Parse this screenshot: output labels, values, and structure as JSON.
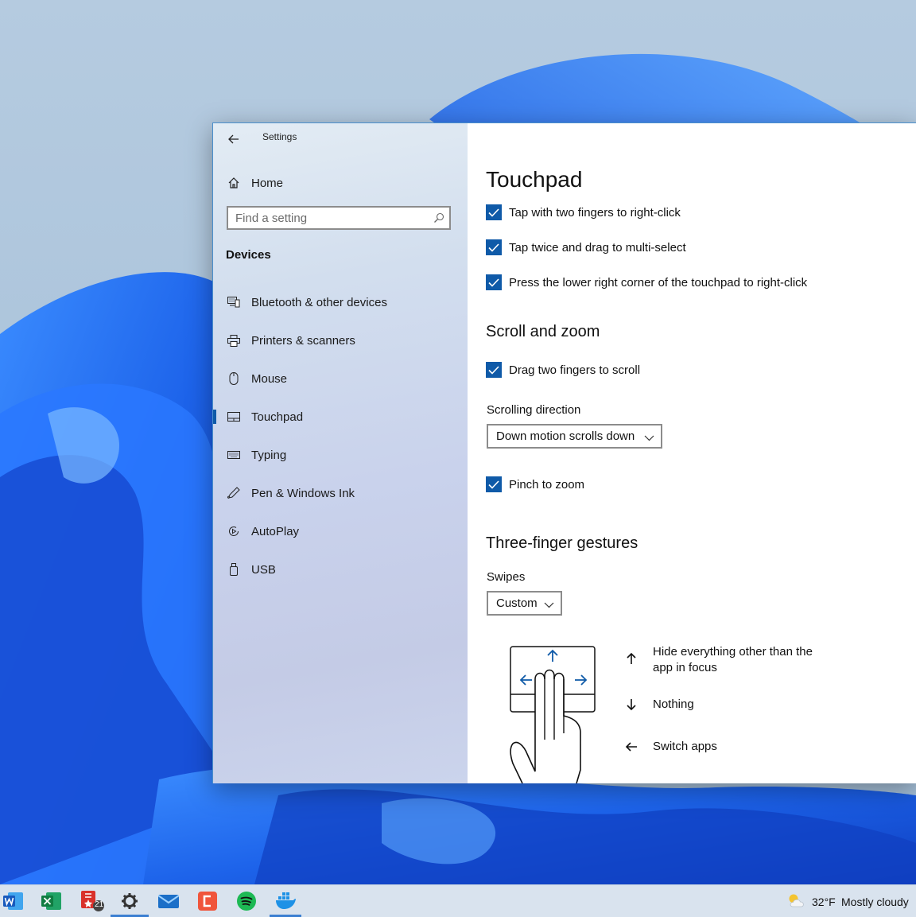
{
  "window": {
    "title": "Settings",
    "back_icon": "back-arrow-icon"
  },
  "sidebar": {
    "home_label": "Home",
    "search_placeholder": "Find a setting",
    "section": "Devices",
    "items": [
      {
        "label": "Bluetooth & other devices",
        "icon": "bluetooth-devices-icon"
      },
      {
        "label": "Printers & scanners",
        "icon": "printer-icon"
      },
      {
        "label": "Mouse",
        "icon": "mouse-icon"
      },
      {
        "label": "Touchpad",
        "icon": "touchpad-icon",
        "selected": true
      },
      {
        "label": "Typing",
        "icon": "keyboard-icon"
      },
      {
        "label": "Pen & Windows Ink",
        "icon": "pen-icon"
      },
      {
        "label": "AutoPlay",
        "icon": "autoplay-icon"
      },
      {
        "label": "USB",
        "icon": "usb-icon"
      }
    ]
  },
  "main": {
    "title": "Touchpad",
    "taps": [
      {
        "label": "Tap with two fingers to right-click",
        "checked": true
      },
      {
        "label": "Tap twice and drag to multi-select",
        "checked": true
      },
      {
        "label": "Press the lower right corner of the touchpad to right-click",
        "checked": true
      }
    ],
    "scroll_zoom": {
      "heading": "Scroll and zoom",
      "drag_scroll": {
        "label": "Drag two fingers to scroll",
        "checked": true
      },
      "direction_label": "Scrolling direction",
      "direction_value": "Down motion scrolls down",
      "pinch": {
        "label": "Pinch to zoom",
        "checked": true
      }
    },
    "three_finger": {
      "heading": "Three-finger gestures",
      "swipes_label": "Swipes",
      "swipes_value": "Custom",
      "gestures": [
        {
          "direction": "up",
          "text": "Hide everything other than the app in focus"
        },
        {
          "direction": "down",
          "text": "Nothing"
        },
        {
          "direction": "left",
          "text": "Switch apps"
        }
      ]
    }
  },
  "taskbar": {
    "apps": [
      "word-icon",
      "excel-icon",
      "acrobat-icon",
      "settings-icon",
      "mail-icon",
      "clipchamp-icon",
      "spotify-icon",
      "docker-icon"
    ],
    "acrobat_badge": "21",
    "active_apps": [
      "settings-icon",
      "docker-icon"
    ],
    "weather": {
      "temp": "32°F",
      "condition": "Mostly cloudy",
      "icon": "cloudy-weather-icon"
    }
  },
  "colors": {
    "accent": "#0f5aa8",
    "wallpaper_blue": "#1f6ff0",
    "window_border": "#4a8fcc"
  }
}
